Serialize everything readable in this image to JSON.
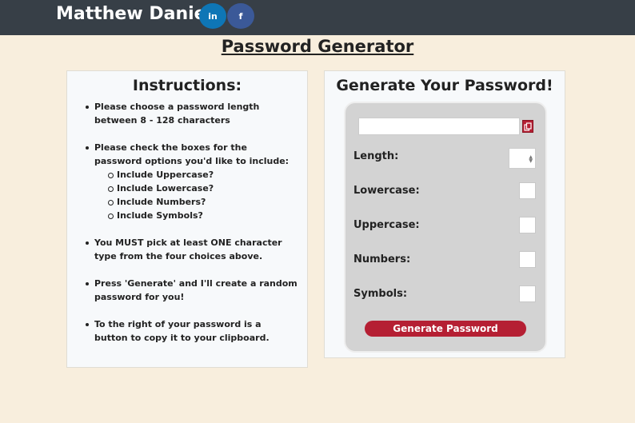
{
  "header": {
    "brand": "Matthew Daniels",
    "social": [
      {
        "label": "in",
        "icon": "linkedin-icon"
      },
      {
        "label": "f",
        "icon": "facebook-icon"
      }
    ]
  },
  "page_title": "Password Generator",
  "instructions": {
    "heading": "Instructions:",
    "items": [
      "Please choose a password length between 8 - 128 characters",
      "Please check the boxes for the password options you'd like to include:",
      "You MUST pick at least ONE character type from the four choices above.",
      "Press 'Generate' and I'll create a random password for you!",
      "To the right of your password is a button to copy it to your clipboard."
    ],
    "sub_items": [
      "Include Uppercase?",
      "Include Lowercase?",
      "Include Numbers?",
      "Include Symbols?"
    ]
  },
  "generator": {
    "heading": "Generate Your Password!",
    "password_value": "",
    "length_label": "Length:",
    "length_value": "",
    "lowercase_label": "Lowercase:",
    "uppercase_label": "Uppercase:",
    "numbers_label": "Numbers:",
    "symbols_label": "Symbols:",
    "button_label": "Generate Password"
  },
  "colors": {
    "topbar": "#373f47",
    "background": "#f8eedd",
    "accent": "#b51f33",
    "linkedin": "#0e76b6",
    "facebook": "#3b5998"
  }
}
